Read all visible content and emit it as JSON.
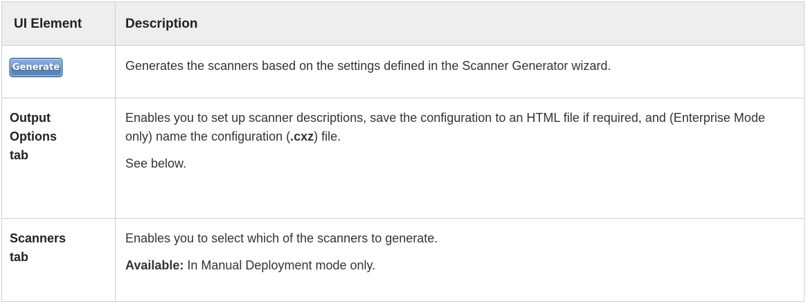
{
  "table": {
    "headers": {
      "ui_element": "UI Element",
      "description": "Description"
    },
    "rows": [
      {
        "element_button_label": "Generate",
        "description": [
          "Generates the scanners based on the settings defined in the Scanner Generator wizard."
        ]
      },
      {
        "element_lines": [
          "Output",
          "Options",
          "tab"
        ],
        "description_part1": "Enables you to set up scanner descriptions, save the configuration to an HTML file if required, and (Enterprise Mode only) name the configuration (",
        "description_bold": ".cxz",
        "description_part2": ") file.",
        "note": "See below."
      },
      {
        "element_lines": [
          "Scanners",
          "tab"
        ],
        "description": "Enables you to select which of the scanners to generate.",
        "availability_label": "Available:",
        "availability_text": " In Manual Deployment mode only."
      }
    ]
  }
}
